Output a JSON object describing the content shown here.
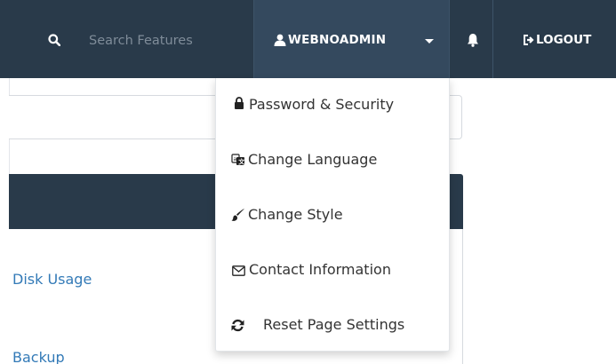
{
  "navbar": {
    "search": {
      "placeholder": "Search Features",
      "icon": "search-icon"
    },
    "user": {
      "label": "WEBNOADMIN",
      "icon": "user-icon"
    },
    "notifications": {
      "icon": "bell-icon"
    },
    "logout": {
      "label": "LOGOUT",
      "icon": "logout-icon"
    }
  },
  "user_menu": {
    "items": [
      {
        "label": "Password & Security",
        "icon": "lock-icon"
      },
      {
        "label": "Change Language",
        "icon": "language-icon"
      },
      {
        "label": "Change Style",
        "icon": "paintbrush-icon"
      },
      {
        "label": "Contact Information",
        "icon": "envelope-icon"
      },
      {
        "label": "Reset Page Settings",
        "icon": "refresh-icon"
      }
    ]
  },
  "page": {
    "links": {
      "disk_usage": "Disk Usage",
      "backup": "Backup"
    }
  },
  "colors": {
    "navbar": "#293a4a",
    "navbar_active": "#34495e",
    "link": "#337ab7"
  }
}
